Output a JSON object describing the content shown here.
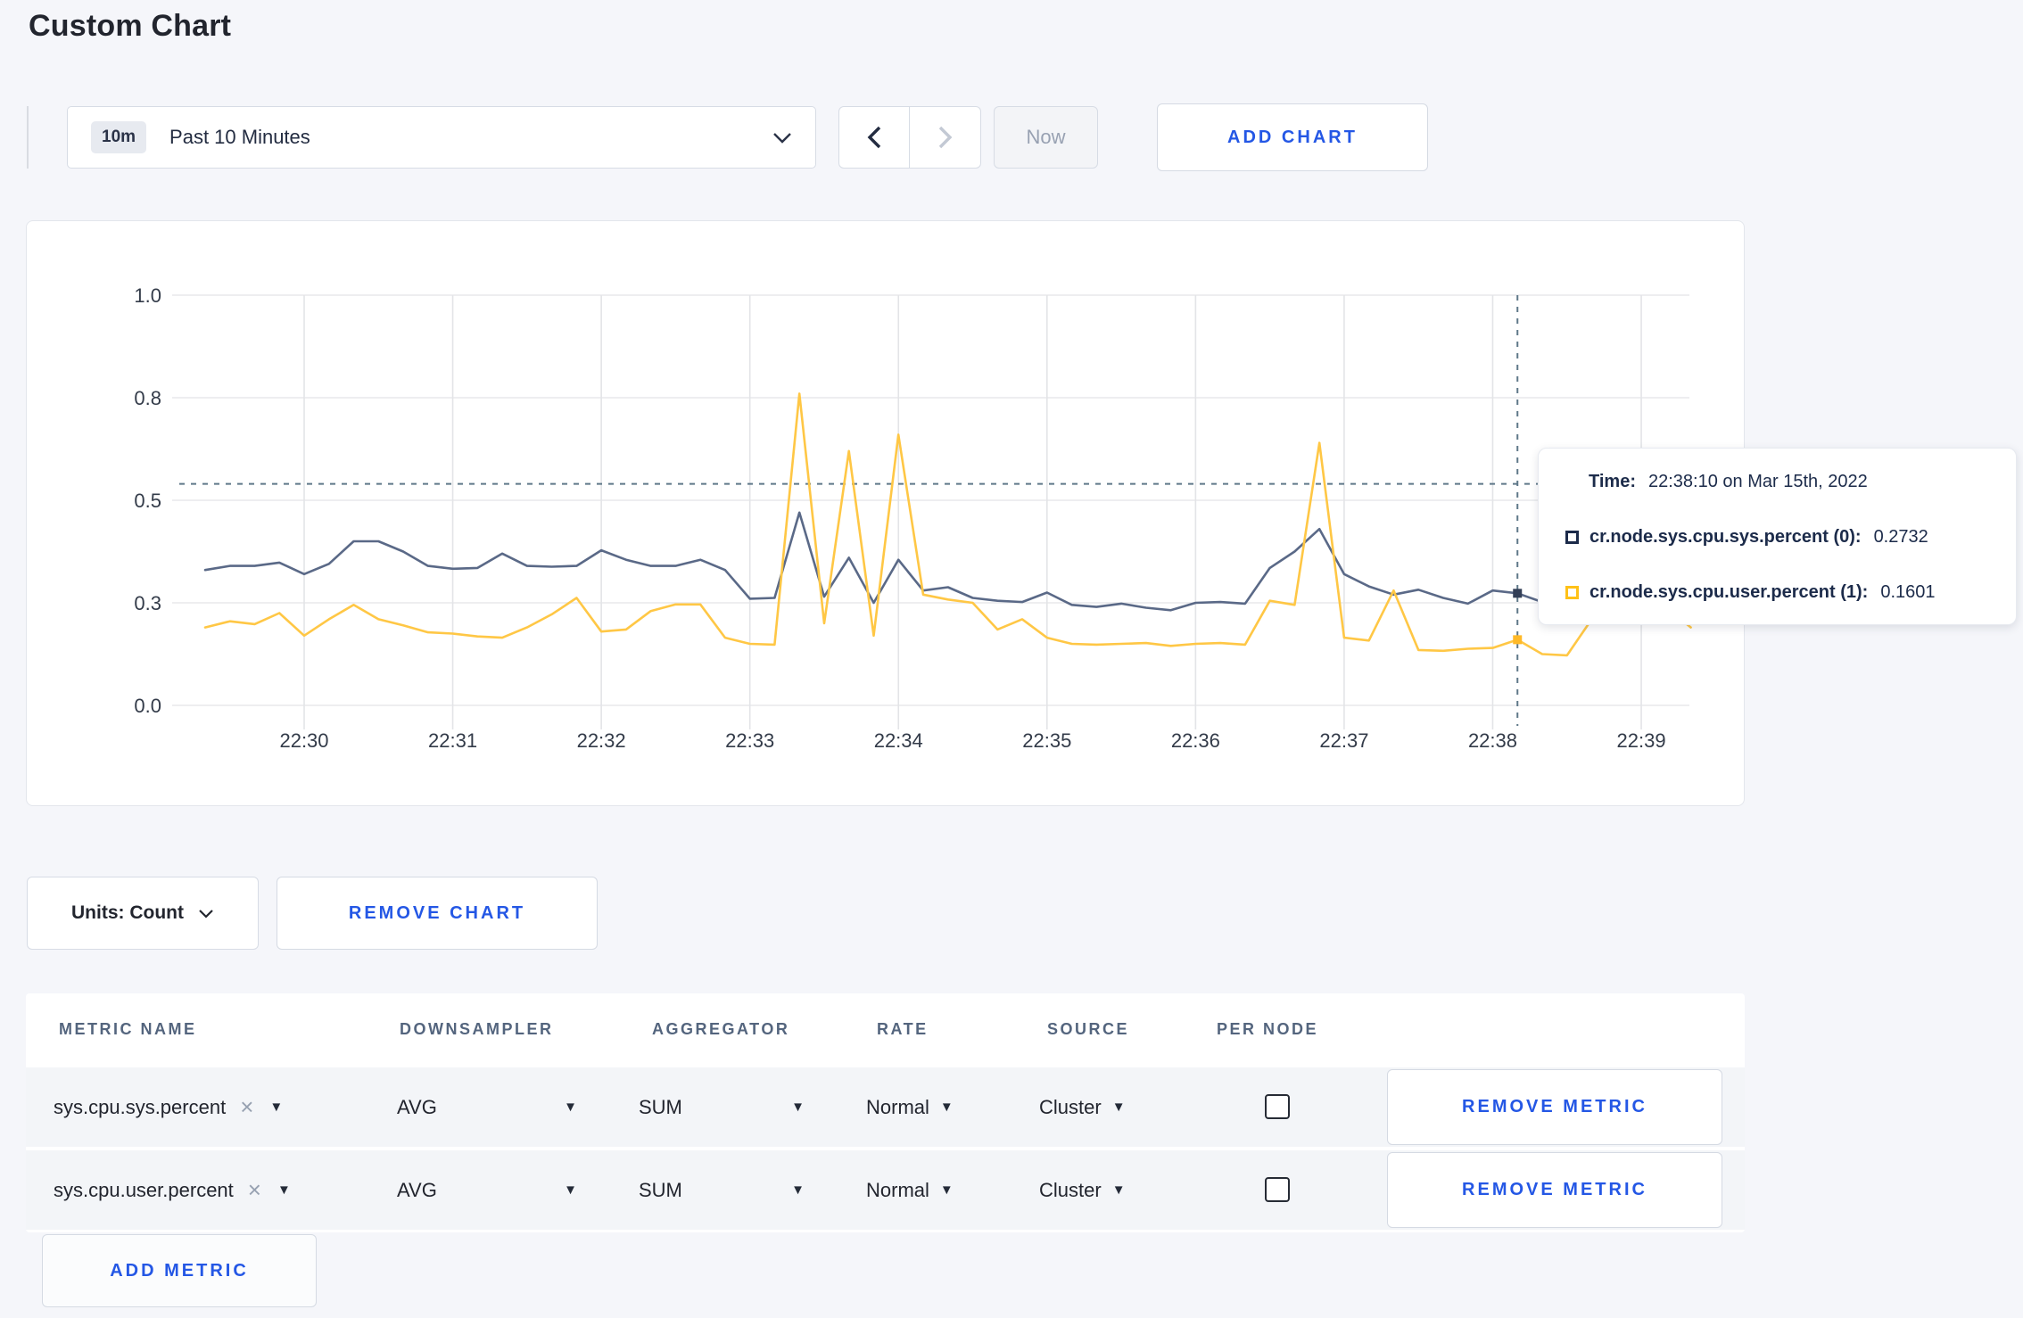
{
  "page": {
    "title": "Custom Chart",
    "background": "#f5f6fa",
    "accent_blue": "#2457e5"
  },
  "toolbar": {
    "time_window_badge": "10m",
    "time_window_label": "Past 10 Minutes",
    "now_label": "Now",
    "add_chart_label": "ADD CHART"
  },
  "icons": {
    "caret_down": "▼",
    "close": "×"
  },
  "tooltip": {
    "time_label": "Time:",
    "time_value": "22:38:10 on Mar 15th, 2022",
    "series": [
      {
        "label": "cr.node.sys.cpu.sys.percent (0):",
        "value": "0.2732",
        "color": "#1c2b4a"
      },
      {
        "label": "cr.node.sys.cpu.user.percent (1):",
        "value": "0.1601",
        "color": "#ffc117"
      }
    ]
  },
  "chart_controls": {
    "units_label": "Units: Count",
    "remove_chart_label": "REMOVE CHART"
  },
  "table": {
    "headers": [
      "METRIC NAME",
      "DOWNSAMPLER",
      "AGGREGATOR",
      "RATE",
      "SOURCE",
      "PER NODE"
    ],
    "rows": [
      {
        "metric": "sys.cpu.sys.percent",
        "downsampler": "AVG",
        "aggregator": "SUM",
        "rate": "Normal",
        "source": "Cluster",
        "per_node_checked": false,
        "remove_label": "REMOVE METRIC"
      },
      {
        "metric": "sys.cpu.user.percent",
        "downsampler": "AVG",
        "aggregator": "SUM",
        "rate": "Normal",
        "source": "Cluster",
        "per_node_checked": false,
        "remove_label": "REMOVE METRIC"
      }
    ],
    "add_metric_label": "ADD METRIC"
  },
  "chart_data": {
    "type": "line",
    "title": "",
    "xlabel": "",
    "ylabel": "",
    "ylim": [
      0,
      1
    ],
    "grid": true,
    "legend_position": "tooltip",
    "x_start": "22:29:20",
    "x_step_seconds": 10,
    "x_ticks": [
      "22:30",
      "22:31",
      "22:32",
      "22:33",
      "22:34",
      "22:35",
      "22:36",
      "22:37",
      "22:38",
      "22:39"
    ],
    "y_ticks": [
      {
        "value": 0.0,
        "label": "0.0"
      },
      {
        "value": 0.25,
        "label": "0.3"
      },
      {
        "value": 0.5,
        "label": "0.5"
      },
      {
        "value": 0.75,
        "label": "0.8"
      },
      {
        "value": 1.0,
        "label": "1.0"
      }
    ],
    "series": [
      {
        "name": "cr.node.sys.cpu.sys.percent",
        "color": "#5a6987",
        "values": [
          0.33,
          0.34,
          0.34,
          0.348,
          0.32,
          0.345,
          0.4,
          0.4,
          0.375,
          0.34,
          0.333,
          0.335,
          0.37,
          0.34,
          0.338,
          0.34,
          0.378,
          0.355,
          0.34,
          0.34,
          0.355,
          0.33,
          0.26,
          0.262,
          0.47,
          0.265,
          0.36,
          0.25,
          0.355,
          0.28,
          0.288,
          0.262,
          0.255,
          0.252,
          0.275,
          0.245,
          0.24,
          0.248,
          0.238,
          0.232,
          0.25,
          0.252,
          0.248,
          0.335,
          0.375,
          0.43,
          0.32,
          0.29,
          0.27,
          0.282,
          0.262,
          0.248,
          0.28,
          0.2732,
          0.252,
          0.248,
          0.26,
          0.27,
          0.262,
          0.28,
          0.29
        ]
      },
      {
        "name": "cr.node.sys.cpu.user.percent",
        "color": "#ffc745",
        "values": [
          0.19,
          0.205,
          0.198,
          0.225,
          0.17,
          0.21,
          0.245,
          0.21,
          0.195,
          0.178,
          0.175,
          0.168,
          0.165,
          0.19,
          0.222,
          0.262,
          0.18,
          0.185,
          0.23,
          0.246,
          0.246,
          0.165,
          0.15,
          0.148,
          0.76,
          0.2,
          0.62,
          0.17,
          0.66,
          0.27,
          0.258,
          0.25,
          0.185,
          0.21,
          0.165,
          0.15,
          0.148,
          0.15,
          0.152,
          0.145,
          0.15,
          0.152,
          0.148,
          0.255,
          0.245,
          0.64,
          0.165,
          0.158,
          0.28,
          0.135,
          0.133,
          0.138,
          0.14,
          0.1601,
          0.125,
          0.122,
          0.21,
          0.27,
          0.265,
          0.24,
          0.19
        ]
      }
    ],
    "crosshair": {
      "time": "22:38:10",
      "hline_value": 0.54,
      "marker_values": [
        0.2732,
        0.1601
      ],
      "marker_colors": [
        "#333f57",
        "#ffb928"
      ]
    }
  }
}
